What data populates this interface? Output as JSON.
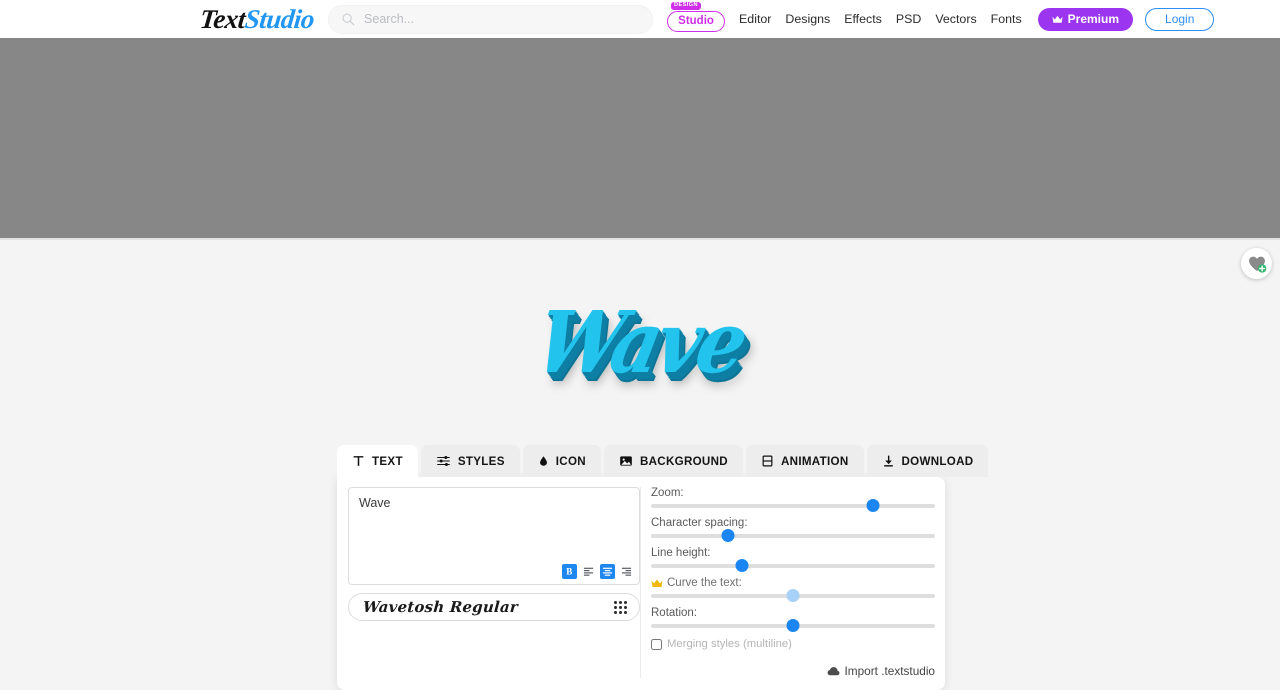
{
  "header": {
    "logo_text_1": "Text",
    "logo_text_2": "Studio",
    "search": {
      "placeholder": "Search...",
      "value": "",
      "icon": "search-icon"
    },
    "design_badge": {
      "tag": "DESIGN",
      "label": "Studio"
    },
    "nav_items": [
      {
        "label": "Editor"
      },
      {
        "label": "Designs"
      },
      {
        "label": "Effects"
      },
      {
        "label": "PSD"
      },
      {
        "label": "Vectors"
      },
      {
        "label": "Fonts"
      }
    ],
    "premium_button": {
      "label": "Premium",
      "icon": "crown-icon",
      "color": "#9c35f0"
    },
    "login_button": {
      "label": "Login",
      "color": "#2f8ef4"
    }
  },
  "banner": {
    "color": "#878787"
  },
  "canvas": {
    "background": "#f4f4f4",
    "artwork_text": "Wave",
    "artwork_color": "#22c3ec",
    "artwork_shadow_color": "#0e7fa4",
    "favorite_fab": {
      "icon": "heart-plus-icon",
      "badge_color": "#2db36b"
    }
  },
  "editor": {
    "tabs": [
      {
        "label": "TEXT",
        "icon": "text-icon",
        "active": true
      },
      {
        "label": "STYLES",
        "icon": "sliders-icon",
        "active": false
      },
      {
        "label": "ICON",
        "icon": "droplet-icon",
        "active": false
      },
      {
        "label": "BACKGROUND",
        "icon": "image-icon",
        "active": false
      },
      {
        "label": "ANIMATION",
        "icon": "film-icon",
        "active": false
      },
      {
        "label": "DOWNLOAD",
        "icon": "download-icon",
        "active": false
      }
    ],
    "text_input": {
      "value": "Wave",
      "placeholder": ""
    },
    "format_buttons": [
      {
        "name": "bold",
        "label": "B",
        "active": true
      },
      {
        "name": "align-left",
        "label": "",
        "active": false
      },
      {
        "name": "align-center",
        "label": "",
        "active": true
      },
      {
        "name": "align-right",
        "label": "",
        "active": false
      }
    ],
    "font_selector": {
      "value": "Wavetosh Regular"
    },
    "sliders": [
      {
        "label": "Zoom:",
        "value": 78,
        "premium": false,
        "muted": false
      },
      {
        "label": "Character spacing:",
        "value": 27,
        "premium": false,
        "muted": false
      },
      {
        "label": "Line height:",
        "value": 32,
        "premium": false,
        "muted": false
      },
      {
        "label": "Curve the text:",
        "value": 50,
        "premium": true,
        "muted": true
      },
      {
        "label": "Rotation:",
        "value": 50,
        "premium": false,
        "muted": false
      }
    ],
    "merging_checkbox": {
      "label": "Merging styles (multiline)",
      "checked": false
    },
    "import_link": {
      "label": "Import .textstudio",
      "icon": "cloud-upload-icon"
    }
  }
}
